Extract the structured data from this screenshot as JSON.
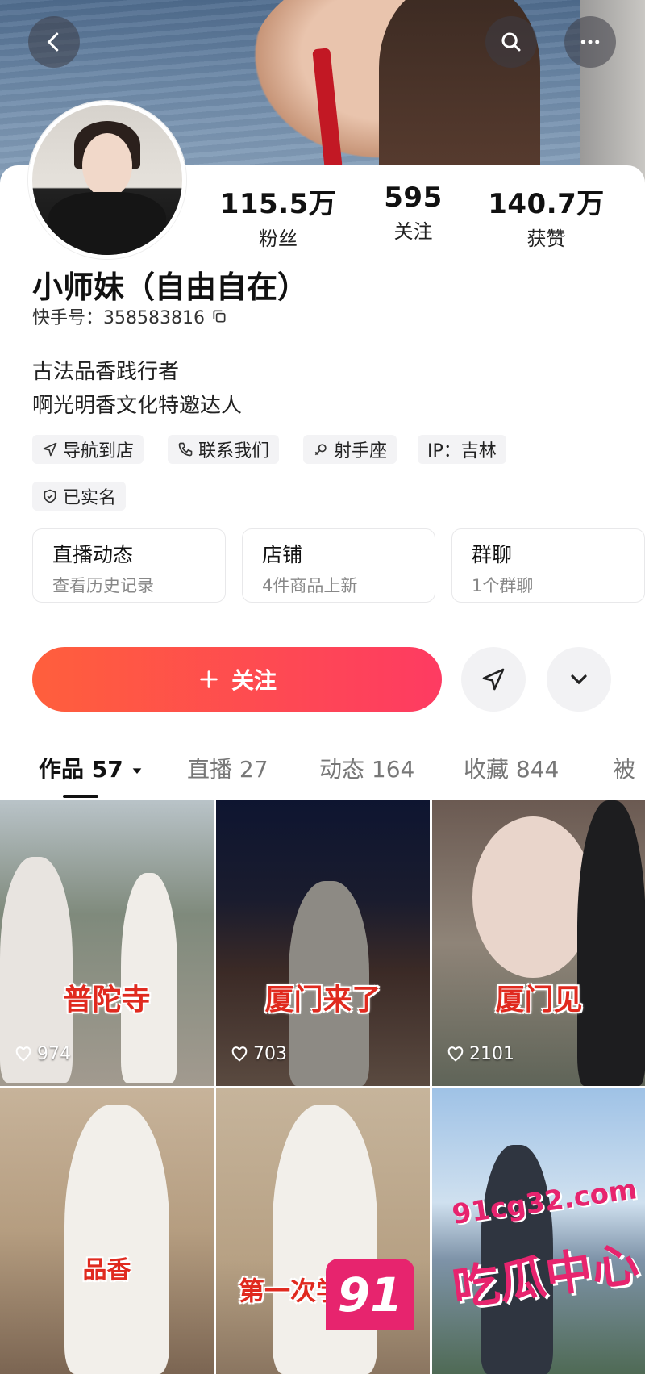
{
  "profile": {
    "stats": [
      {
        "value": "115.5万",
        "label": "粉丝"
      },
      {
        "value": "595",
        "label": "关注"
      },
      {
        "value": "140.7万",
        "label": "获赞"
      }
    ],
    "name": "小师妹（自由自在）",
    "kuaishou_id": "快手号：358583816",
    "bio_lines": [
      "古法品香践行者",
      "啊光明香文化特邀达人"
    ],
    "tags": [
      "导航到店",
      "联系我们",
      "射手座",
      "IP：吉林",
      "已实名"
    ]
  },
  "features": [
    {
      "title": "直播动态",
      "subtitle": "查看历史记录"
    },
    {
      "title": "店铺",
      "subtitle": "4件商品上新"
    },
    {
      "title": "群聊",
      "subtitle": "1个群聊"
    }
  ],
  "actions": {
    "follow_label": "关注"
  },
  "tabs": [
    {
      "label": "作品 57"
    },
    {
      "label": "直播 27"
    },
    {
      "label": "动态 164"
    },
    {
      "label": "收藏 844"
    },
    {
      "label": "被"
    }
  ],
  "videos": [
    {
      "caption": "普陀寺",
      "likes": "974"
    },
    {
      "caption": "厦门来了",
      "likes": "703"
    },
    {
      "caption": "厦门见",
      "likes": "2101"
    },
    {
      "caption": "品香",
      "likes": ""
    },
    {
      "caption": "第一次学",
      "likes": ""
    },
    {
      "caption": "",
      "likes": ""
    }
  ],
  "watermark": {
    "badge": "91",
    "url": "91cg32.com",
    "text": "吃瓜中心"
  },
  "icons": {
    "back": "chevron-left-icon",
    "search": "search-icon",
    "more": "more-icon",
    "copy": "copy-icon",
    "send": "send-icon",
    "expand": "chevron-down-icon",
    "like": "heart-icon"
  },
  "colors": {
    "follow_start": "#ff5f3c",
    "follow_end": "#fe3b62",
    "caption": "#e02a1f",
    "watermark": "#e7246e"
  }
}
